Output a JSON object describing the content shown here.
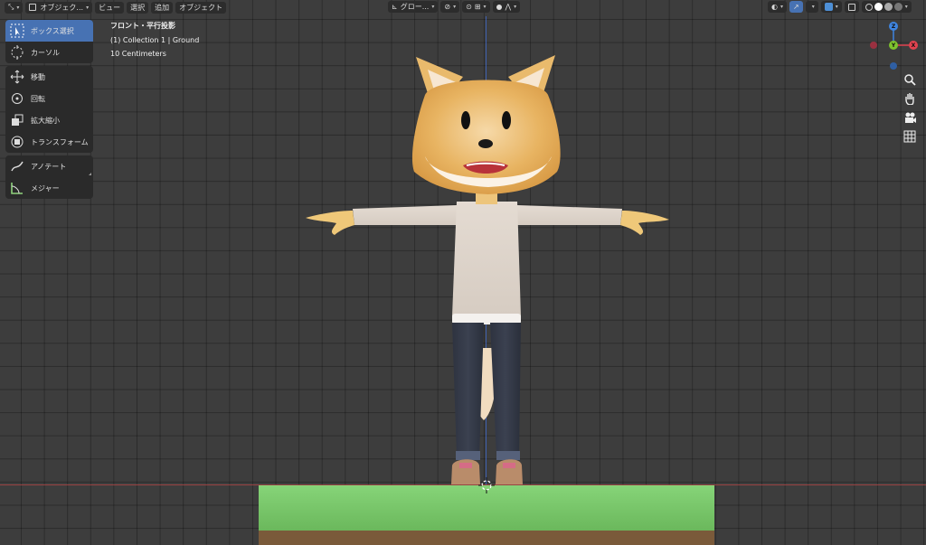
{
  "header": {
    "mode_label": "オブジェク...",
    "menus": [
      "ビュー",
      "選択",
      "追加",
      "オブジェクト"
    ],
    "transform_orientation": "グロー..."
  },
  "toolbar": {
    "items": [
      {
        "label": "ボックス選択",
        "icon": "box-select-icon",
        "active": true
      },
      {
        "label": "カーソル",
        "icon": "cursor-icon"
      },
      {
        "label": "移動",
        "icon": "move-icon"
      },
      {
        "label": "回転",
        "icon": "rotate-icon"
      },
      {
        "label": "拡大縮小",
        "icon": "scale-icon"
      },
      {
        "label": "トランスフォーム",
        "icon": "transform-icon"
      },
      {
        "label": "アノテート",
        "icon": "annotate-icon"
      },
      {
        "label": "メジャー",
        "icon": "measure-icon"
      }
    ]
  },
  "viewport_info": {
    "view_name": "フロント・平行投影",
    "collection": "(1) Collection 1 | Ground",
    "scale": "10 Centimeters"
  },
  "gizmo": {
    "x_label": "X",
    "y_label": "Y",
    "z_label": "Z",
    "colors": {
      "x": "#e0424f",
      "y": "#7ec22d",
      "z": "#3f85e0"
    }
  },
  "colors": {
    "accent": "#4772b3",
    "ground_green": "#7bc96a",
    "ground_brown": "#7a5a3a",
    "axis_red": "#b04545",
    "axis_blue": "#3e6bd6"
  }
}
